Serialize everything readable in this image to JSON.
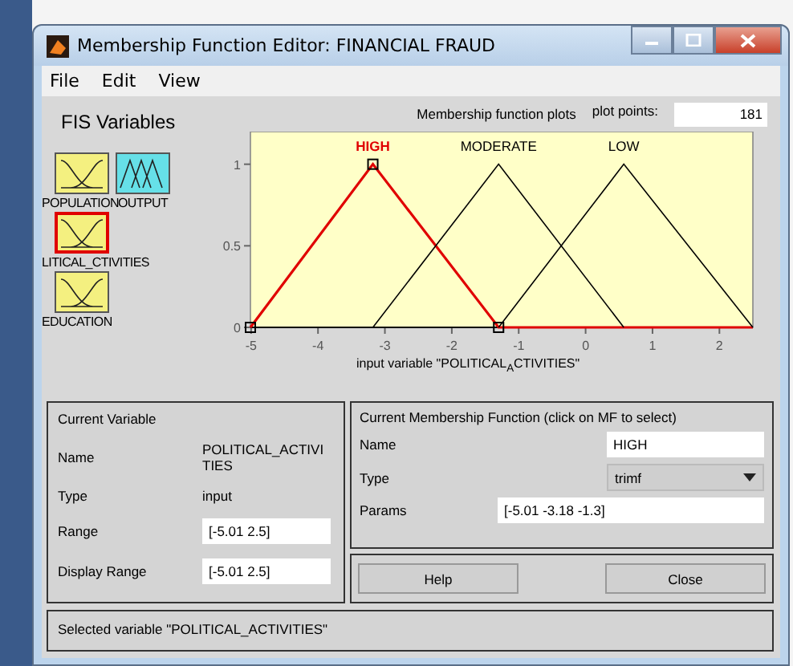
{
  "window": {
    "title": "Membership Function Editor: FINANCIAL FRAUD"
  },
  "menu": [
    "File",
    "Edit",
    "View"
  ],
  "fis_variables": {
    "title": "FIS Variables",
    "items": [
      {
        "label": "POPULATION",
        "kind": "input",
        "selected": false
      },
      {
        "label": "OUTPUT",
        "kind": "output",
        "selected": false
      },
      {
        "label": "LITICAL_CTIVITIES",
        "kind": "input",
        "selected": true
      },
      {
        "label": "EDUCATION",
        "kind": "input",
        "selected": false
      }
    ]
  },
  "plot": {
    "title": "Membership function plots",
    "plot_points_label": "plot points:",
    "plot_points": "181",
    "chart_data": {
      "type": "line",
      "xlabel": "input variable \"POLITICAL$_{A}$CTIVITIES\"",
      "x": [
        -5.01,
        -3.18,
        -1.3,
        0.57,
        2.5
      ],
      "series": [
        {
          "name": "HIGH",
          "color": "#e00000",
          "values": [
            0,
            1,
            0,
            0,
            0
          ]
        },
        {
          "name": "MODERATE",
          "color": "#000000",
          "values": [
            null,
            0,
            1,
            0,
            null
          ]
        },
        {
          "name": "LOW",
          "color": "#000000",
          "values": [
            null,
            null,
            0,
            1,
            0
          ]
        }
      ],
      "xlim": [
        -5.01,
        2.5
      ],
      "ylim": [
        0,
        1.2
      ],
      "xticks": [
        -5,
        -4,
        -3,
        -2,
        -1,
        0,
        1,
        2
      ],
      "yticks": [
        0,
        0.5,
        1
      ]
    }
  },
  "current_variable": {
    "title": "Current Variable",
    "fields": [
      {
        "label": "Name",
        "value": "POLITICAL_ACTIVITIES",
        "kind": "text"
      },
      {
        "label": "Type",
        "value": "input",
        "kind": "text"
      },
      {
        "label": "Range",
        "value": "[-5.01 2.5]",
        "kind": "input"
      },
      {
        "label": "Display Range",
        "value": "[-5.01 2.5]",
        "kind": "input"
      }
    ]
  },
  "current_mf": {
    "title": "Current Membership Function (click on MF to select)",
    "name_label": "Name",
    "name": "HIGH",
    "type_label": "Type",
    "type": "trimf",
    "params_label": "Params",
    "params": "[-5.01 -3.18 -1.3]"
  },
  "buttons": [
    "Help",
    "Close"
  ],
  "status_bar": "Selected variable \"POLITICAL_ACTIVITIES\""
}
